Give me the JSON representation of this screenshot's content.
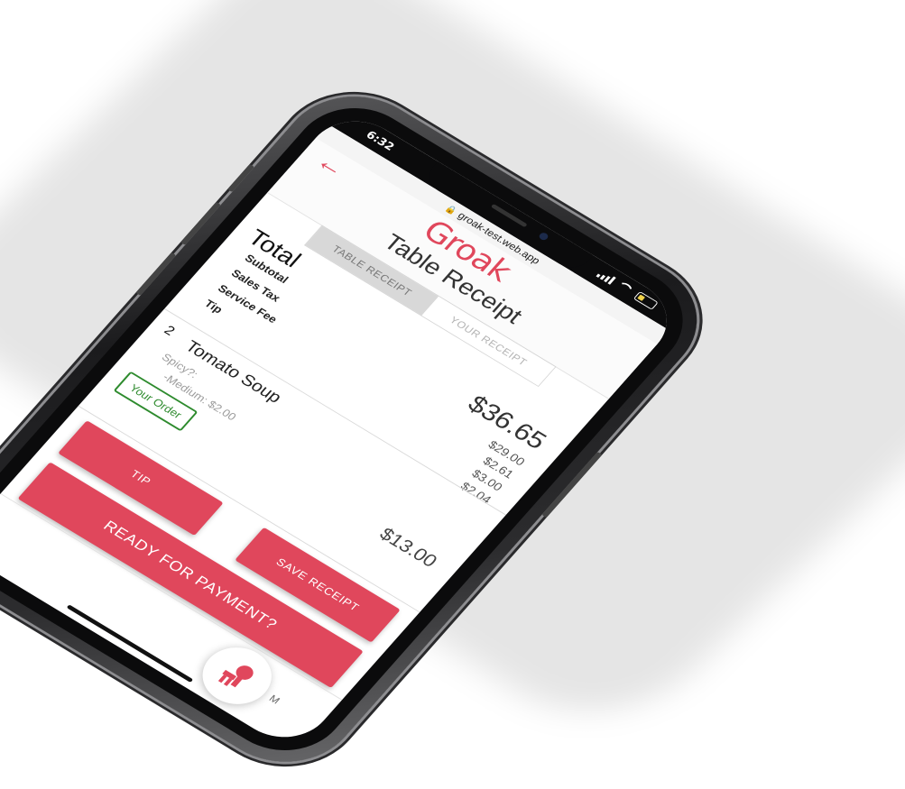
{
  "status_bar": {
    "time": "6:32"
  },
  "browser": {
    "url": "groak-test.web.app"
  },
  "header": {
    "back_icon": "arrow-left-icon",
    "logo_text": "Groak",
    "title": "Table Receipt"
  },
  "tabs": [
    {
      "label": "TABLE RECEIPT",
      "active": true
    },
    {
      "label": "YOUR RECEIPT",
      "active": false
    }
  ],
  "totals": {
    "total_label": "Total",
    "total_amount": "$36.65",
    "lines": [
      {
        "label": "Subtotal",
        "value": "$29.00"
      },
      {
        "label": "Sales Tax",
        "value": "$2.61"
      },
      {
        "label": "Service Fee",
        "value": "$3.00"
      },
      {
        "label": "Tip",
        "value": "$2.04"
      }
    ]
  },
  "order_item": {
    "quantity": "2",
    "name": "Tomato Soup",
    "option_label": "Spicy?:",
    "option_value": "-Medium: $2.00",
    "badge": "Your Order",
    "price": "$13.00"
  },
  "buttons": {
    "tip": "TIP",
    "save_receipt": "SAVE RECEIPT",
    "ready": "READY FOR PAYMENT?"
  },
  "fab": {
    "icon": "groak-waiter-icon",
    "suffix": "M"
  },
  "colors": {
    "accent": "#e0475c",
    "badge_green": "#2e8b2e"
  }
}
